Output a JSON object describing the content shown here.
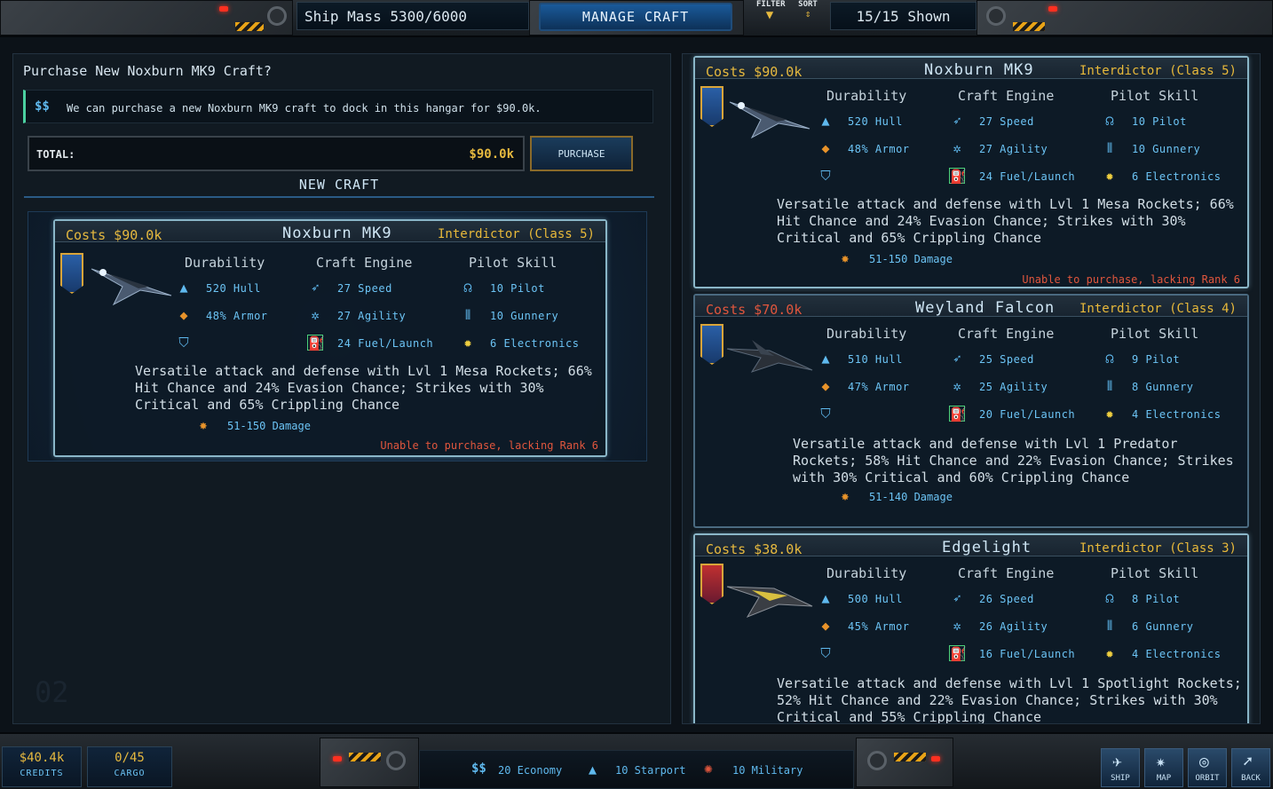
{
  "topbar": {
    "ship_mass": "Ship Mass 5300/6000",
    "manage_label": "MANAGE CRAFT",
    "filter_label": "FILTER",
    "sort_label": "SORT",
    "shown": "15/15 Shown"
  },
  "left": {
    "title": "Purchase New Noxburn MK9 Craft?",
    "info_icon": "$$",
    "info_text": "We can purchase a new Noxburn MK9 craft to dock in this hangar for $90.0k.",
    "total_label": "TOTAL:",
    "total_value": "$90.0k",
    "purchase_label": "PURCHASE",
    "section_title": "NEW CRAFT",
    "watermark": "02"
  },
  "headers": {
    "durability": "Durability",
    "engine": "Craft Engine",
    "pilot": "Pilot Skill"
  },
  "selected_card": {
    "cost": "Costs $90.0k",
    "name": "Noxburn MK9",
    "class": "Interdictor (Class 5)",
    "hull": "520 Hull",
    "armor": "48% Armor",
    "speed": "27 Speed",
    "agility": "27 Agility",
    "fuel": "24 Fuel/Launch",
    "pilot": "10 Pilot",
    "gunnery": "10 Gunnery",
    "electronics": "6 Electronics",
    "desc": "Versatile attack and defense with Lvl 1 Mesa Rockets; 66% Hit Chance and 24% Evasion Chance; Strikes with 30% Critical and 65% Crippling Chance",
    "damage": "51-150 Damage",
    "lacking": "Unable to purchase, lacking Rank 6"
  },
  "list": [
    {
      "cost": "Costs $90.0k",
      "name": "Noxburn MK9",
      "class": "Interdictor (Class 5)",
      "hull": "520 Hull",
      "armor": "48% Armor",
      "speed": "27 Speed",
      "agility": "27 Agility",
      "fuel": "24 Fuel/Launch",
      "pilot": "10 Pilot",
      "gunnery": "10 Gunnery",
      "electronics": "6 Electronics",
      "desc": "Versatile attack and defense with Lvl 1 Mesa Rockets; 66% Hit Chance and 24% Evasion Chance; Strikes with 30% Critical and 65% Crippling Chance",
      "damage": "51-150 Damage",
      "lacking": "Unable to purchase, lacking Rank 6"
    },
    {
      "cost": "Costs $70.0k",
      "name": "Weyland Falcon",
      "class": "Interdictor (Class 4)",
      "hull": "510 Hull",
      "armor": "47% Armor",
      "speed": "25 Speed",
      "agility": "25 Agility",
      "fuel": "20 Fuel/Launch",
      "pilot": "9 Pilot",
      "gunnery": "8 Gunnery",
      "electronics": "4 Electronics",
      "desc": "Versatile attack and defense with Lvl 1 Predator Rockets; 58% Hit Chance and 22% Evasion Chance; Strikes with 30% Critical and 60% Crippling Chance",
      "damage": "51-140 Damage"
    },
    {
      "cost": "Costs $38.0k",
      "name": "Edgelight",
      "class": "Interdictor (Class 3)",
      "hull": "500 Hull",
      "armor": "45% Armor",
      "speed": "26 Speed",
      "agility": "26 Agility",
      "fuel": "16 Fuel/Launch",
      "pilot": "8 Pilot",
      "gunnery": "6 Gunnery",
      "electronics": "4 Electronics",
      "desc": "Versatile attack and defense with Lvl 1 Spotlight Rockets; 52% Hit Chance and 22% Evasion Chance; Strikes with 30% Critical and 55% Crippling Chance"
    }
  ],
  "bottombar": {
    "credits_value": "$40.4k",
    "credits_label": "CREDITS",
    "cargo_value": "0/45",
    "cargo_label": "CARGO",
    "economy": "20 Economy",
    "starport": "10 Starport",
    "military": "10 Military",
    "nav": {
      "ship": "SHIP",
      "map": "MAP",
      "orbit": "ORBIT",
      "back": "BACK"
    }
  },
  "colors": {
    "accent_blue": "#5fb9ee",
    "gold": "#e6b93f",
    "warning_red": "#e0563d",
    "card_border": "#8ab6c8"
  }
}
